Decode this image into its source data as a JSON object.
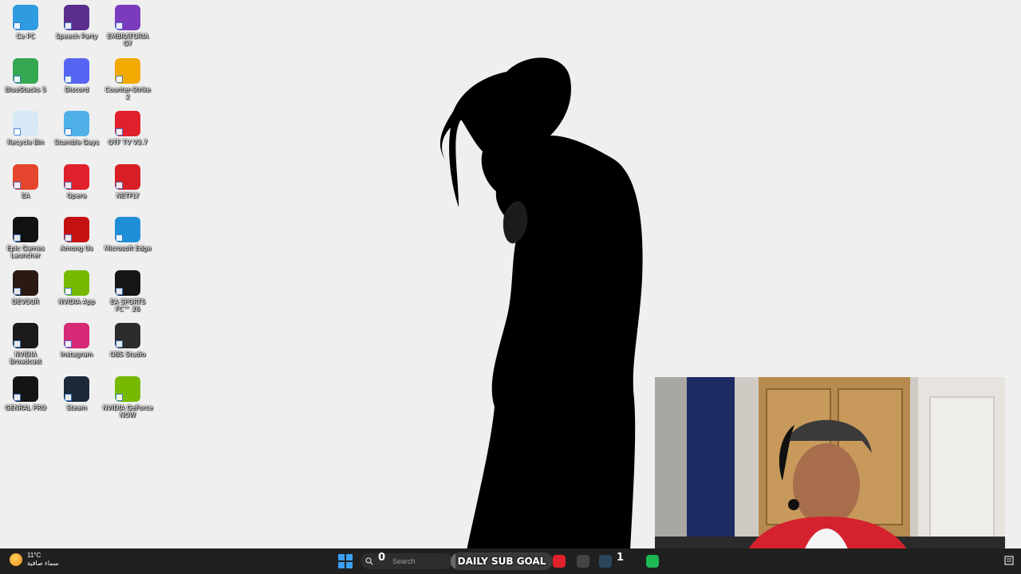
{
  "desktop": {
    "icons": [
      {
        "label": "Ce PC",
        "icon": "computer-monitor-icon",
        "color": "#2f9be0"
      },
      {
        "label": "Speech Party",
        "icon": "party-game-icon",
        "color": "#5a2d8c"
      },
      {
        "label": "EMBRATORIA GY",
        "icon": "e-logo-icon",
        "color": "#7b3bbd"
      },
      {
        "label": "BlueStacks 5",
        "icon": "bluestacks-icon",
        "color": "#36a852"
      },
      {
        "label": "Discord",
        "icon": "discord-icon",
        "color": "#5865f2"
      },
      {
        "label": "Counter-Strike 2",
        "icon": "counter-strike-icon",
        "color": "#f2a900"
      },
      {
        "label": "Recycle Bin",
        "icon": "recycle-bin-icon",
        "color": "#d7e9f5"
      },
      {
        "label": "Stumble Guys",
        "icon": "stumble-guys-icon",
        "color": "#4fb0e8"
      },
      {
        "label": "OTF TV V3.7",
        "icon": "play-logo-icon",
        "color": "#e0202a"
      },
      {
        "label": "EA",
        "icon": "ea-icon",
        "color": "#e5452c"
      },
      {
        "label": "Opera",
        "icon": "opera-icon",
        "color": "#e0202a"
      },
      {
        "label": "NETFLY",
        "icon": "netfly-icon",
        "color": "#d81f26"
      },
      {
        "label": "Epic Games Launcher",
        "icon": "epic-games-icon",
        "color": "#111111"
      },
      {
        "label": "Among Us",
        "icon": "among-us-icon",
        "color": "#c51111"
      },
      {
        "label": "Microsoft Edge",
        "icon": "edge-icon",
        "color": "#1e8fd6"
      },
      {
        "label": "DEVOUR",
        "icon": "devour-icon",
        "color": "#2a1a12"
      },
      {
        "label": "NVIDIA App",
        "icon": "nvidia-icon",
        "color": "#76b900"
      },
      {
        "label": "EA SPORTS FC™ 26",
        "icon": "ea-sports-fc-icon",
        "color": "#161616"
      },
      {
        "label": "NVIDIA Broadcast",
        "icon": "nvidia-broadcast-icon",
        "color": "#1a1a1a"
      },
      {
        "label": "Instagram",
        "icon": "instagram-icon",
        "color": "#d62976"
      },
      {
        "label": "OBS Studio",
        "icon": "obs-icon",
        "color": "#2b2b2b"
      },
      {
        "label": "GENRAL PRO",
        "icon": "genral-pro-icon",
        "color": "#141414"
      },
      {
        "label": "Steam",
        "icon": "steam-icon",
        "color": "#1b2838"
      },
      {
        "label": "NVIDIA GeForce NOW",
        "icon": "geforce-now-icon",
        "color": "#76b900"
      }
    ]
  },
  "wallpaper": {
    "subject": "silhouette-figure"
  },
  "webcam": {
    "label": "webcam-feed"
  },
  "taskbar": {
    "weather": {
      "temperature": "11°C",
      "condition": "سماء صافية"
    },
    "search_placeholder": "Search",
    "sub_count": "0",
    "sub_goal_label": "DAILY SUB GOAL",
    "sub_goal_progress": 0.05,
    "sub_goal_target": "1",
    "apps": [
      {
        "icon": "opera-icon",
        "color": "#e0202a"
      },
      {
        "icon": "obs-icon",
        "color": "#444444"
      },
      {
        "icon": "steam-icon",
        "color": "#2a475e"
      },
      {
        "icon": "spotify-icon",
        "color": "#1db954"
      }
    ]
  }
}
